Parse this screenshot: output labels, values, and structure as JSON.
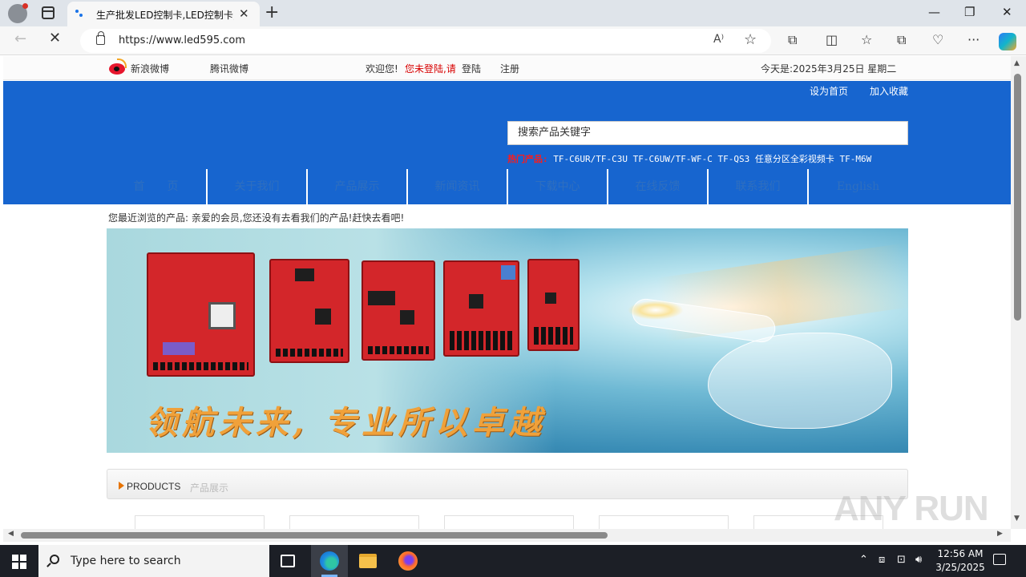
{
  "browser": {
    "tab_title": "生产批发LED控制卡,LED控制卡,G",
    "tab_close": "✕",
    "new_tab": "+",
    "url": "https://www.led595.com",
    "window_minimize": "—",
    "window_maximize": "❐",
    "window_close": "✕",
    "back": "←",
    "stop": "✕",
    "read_aloud": "A⁾",
    "favorite": "☆",
    "more": "···"
  },
  "topstrip": {
    "weibo": "新浪微博",
    "tencent": "腾讯微博",
    "welcome": "欢迎您!",
    "not_logged": "您未登陆,请",
    "login": "登陆",
    "register": "注册",
    "today": "今天是:2025年3月25日 星期二"
  },
  "header": {
    "set_home": "设为首页",
    "add_fav": "加入收藏",
    "search_placeholder": "搜索产品关键字",
    "hot_label": "热门产品:",
    "hot_products": "TF-C6UR/TF-C3U TF-C6UW/TF-WF-C TF-QS3 任意分区全彩视频卡 TF-M6W"
  },
  "nav": [
    {
      "label": "首　　页"
    },
    {
      "label": "关于我们"
    },
    {
      "label": "产品展示"
    },
    {
      "label": "新闻资讯"
    },
    {
      "label": "下载中心"
    },
    {
      "label": "在线反馈"
    },
    {
      "label": "联系我们"
    },
    {
      "label": "English"
    }
  ],
  "recent": "您最近浏览的产品: 亲爱的会员,您还没有去看我们的产品!赶快去看吧!",
  "banner": {
    "slogan": "领航未来, 专业所以卓越"
  },
  "products": {
    "title_en": "PRODUCTS",
    "title_cn": "产品展示"
  },
  "watermark": "ANY RUN",
  "taskbar": {
    "search_text": "Type here to search",
    "time": "12:56 AM",
    "date": "3/25/2025"
  },
  "colors": {
    "header_blue": "#1765cf",
    "hot_red": "#ff1a1a",
    "slogan_orange": "#f0a13a"
  }
}
